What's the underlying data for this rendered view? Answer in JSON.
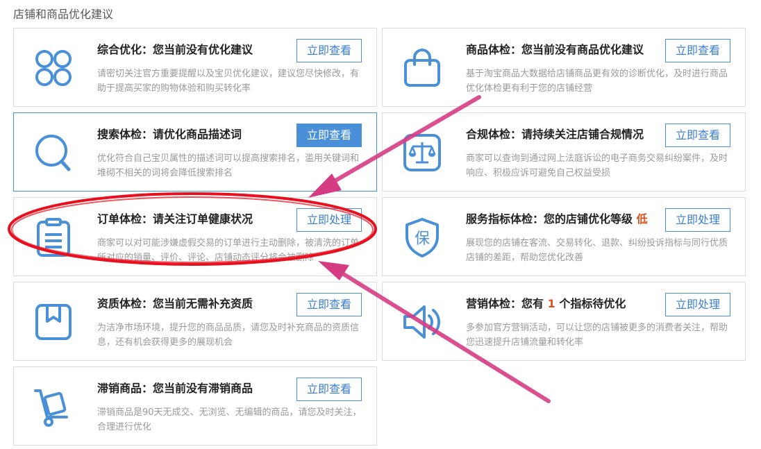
{
  "section_title": "店铺和商品优化建议",
  "cards": [
    {
      "icon": "four-circles-icon",
      "title_prefix": "综合优化：您当前没有优化建议",
      "title_highlight": "",
      "title_suffix": "",
      "desc": "请密切关注官方重要提醒以及宝贝优化建议，建议您尽快修改，有助于提高买家的购物体验和购买转化率",
      "button": "立即查看"
    },
    {
      "icon": "shopping-bag-icon",
      "title_prefix": "商品体检：您当前没有商品优化建议",
      "title_highlight": "",
      "title_suffix": "",
      "desc": "基于淘宝商品大数据给店铺商品更有效的诊断优化，及时进行商品优化体检更有利于您的店铺经营",
      "button": "立即查看"
    },
    {
      "icon": "search-icon",
      "title_prefix": "搜索体检：请优化商品描述词",
      "title_highlight": "",
      "title_suffix": "",
      "desc": "优化符合自己宝贝属性的描述词可以提高搜索排名，滥用关键词和堆砌不相关的词将会降低搜索排名",
      "button": "立即查看"
    },
    {
      "icon": "scales-icon",
      "title_prefix": "合规体检：请持续关注店铺合规情况",
      "title_highlight": "",
      "title_suffix": "",
      "desc": "商家可以查询到通过网上法庭诉讼的电子商务交易纠纷案件，及时响应、积极应诉可避免自己权益受损",
      "button": "立即查看"
    },
    {
      "icon": "clipboard-icon",
      "title_prefix": "订单体检：请关注订单健康状况",
      "title_highlight": "",
      "title_suffix": "",
      "desc": "商家可以对可能涉嫌虚假交易的订单进行主动删除，被清洗的订单所对应的销量、评价、评论、店铺动态评分将会被删除",
      "button": "立即处理"
    },
    {
      "icon": "shield-bao-icon",
      "shield_char": "保",
      "title_prefix": "服务指标体检：您的店铺优化等级",
      "title_highlight": "低",
      "title_suffix": "",
      "desc": "展现您的店铺在客流、交易转化、退款、纠纷投诉指标与同行优质店铺的差距，帮助您优化改善",
      "button": "立即处理"
    },
    {
      "icon": "package-icon",
      "title_prefix": "资质体检：您当前无需补充资质",
      "title_highlight": "",
      "title_suffix": "",
      "desc": "为洁净市场环境，提升您的商品品质，请您及时补充商品的资质信息，还有机会获得更多的展现机会",
      "button": "立即查看"
    },
    {
      "icon": "speaker-icon",
      "title_prefix": "营销体检：您有",
      "title_highlight": "1",
      "title_suffix": "个指标待优化",
      "desc": "多参加官方营销活动，可以让您的店铺被更多的消费者关注，帮助您迅速提升店铺流量和转化率",
      "button": "立即处理"
    },
    {
      "icon": "hand-truck-icon",
      "title_prefix": "滞销商品：您当前没有滞销商品",
      "title_highlight": "",
      "title_suffix": "",
      "desc": "滞销商品是90天无成交、无浏览、无编辑的商品，请您及时关注，合理进行优化",
      "button": "立即查看"
    }
  ],
  "colors": {
    "icon_blue": "#4a90d9",
    "highlight_red": "#e0501e",
    "annotation_red": "#e8101e",
    "arrow_pink": "#d63c84"
  }
}
